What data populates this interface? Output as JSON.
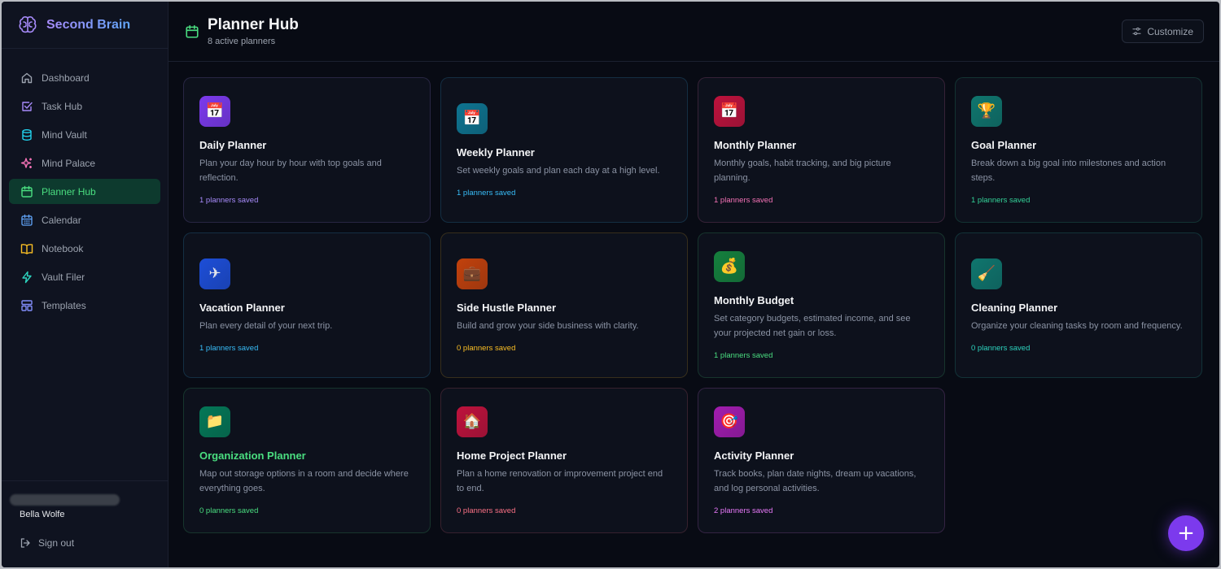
{
  "brand": {
    "name": "Second Brain"
  },
  "sidebar": {
    "items": [
      {
        "label": "Dashboard",
        "icon": "home-icon"
      },
      {
        "label": "Task Hub",
        "icon": "checkbox-icon"
      },
      {
        "label": "Mind Vault",
        "icon": "database-icon"
      },
      {
        "label": "Mind Palace",
        "icon": "sparkles-icon"
      },
      {
        "label": "Planner Hub",
        "icon": "calendar-icon",
        "active": true
      },
      {
        "label": "Calendar",
        "icon": "calendar-grid-icon"
      },
      {
        "label": "Notebook",
        "icon": "book-icon"
      },
      {
        "label": "Vault Filer",
        "icon": "lightning-icon"
      },
      {
        "label": "Templates",
        "icon": "layout-icon"
      }
    ],
    "user": {
      "name": "Bella Wolfe"
    },
    "signout_label": "Sign out"
  },
  "header": {
    "title": "Planner Hub",
    "subtitle": "8 active planners",
    "customize_label": "Customize"
  },
  "cards": [
    {
      "title": "Daily Planner",
      "desc": "Plan your day hour by hour with top goals and reflection.",
      "status": "1 planners saved",
      "icon": "calendar-icon",
      "emoji": "📅",
      "color": "#a78bfa",
      "icon_bg": "#7c3aed"
    },
    {
      "title": "Weekly Planner",
      "desc": "Set weekly goals and plan each day at a high level.",
      "status": "1 planners saved",
      "icon": "calendar-icon",
      "emoji": "📅",
      "color": "#38bdf8",
      "icon_bg": "#0e7490"
    },
    {
      "title": "Monthly Planner",
      "desc": "Monthly goals, habit tracking, and big picture planning.",
      "status": "1 planners saved",
      "icon": "calendar-icon",
      "emoji": "📅",
      "color": "#f472b6",
      "icon_bg": "#be123c"
    },
    {
      "title": "Goal Planner",
      "desc": "Break down a big goal into milestones and action steps.",
      "status": "1 planners saved",
      "icon": "trophy-icon",
      "emoji": "🏆",
      "color": "#34d399",
      "icon_bg": "#0f766e"
    },
    {
      "title": "Vacation Planner",
      "desc": "Plan every detail of your next trip.",
      "status": "1 planners saved",
      "icon": "airplane-icon",
      "emoji": "✈",
      "color": "#38bdf8",
      "icon_bg": "#1d4ed8"
    },
    {
      "title": "Side Hustle Planner",
      "desc": "Build and grow your side business with clarity.",
      "status": "0 planners saved",
      "icon": "briefcase-icon",
      "emoji": "💼",
      "color": "#fbbf24",
      "icon_bg": "#c2410c"
    },
    {
      "title": "Monthly Budget",
      "desc": "Set category budgets, estimated income, and see your projected net gain or loss.",
      "status": "1 planners saved",
      "icon": "money-bag-icon",
      "emoji": "💰",
      "color": "#4ade80",
      "icon_bg": "#15803d"
    },
    {
      "title": "Cleaning Planner",
      "desc": "Organize your cleaning tasks by room and frequency.",
      "status": "0 planners saved",
      "icon": "broom-icon",
      "emoji": "🧹",
      "color": "#2dd4bf",
      "icon_bg": "#0f766e"
    },
    {
      "title": "Organization Planner",
      "desc": "Map out storage options in a room and decide where everything goes.",
      "status": "0 planners saved",
      "icon": "folder-icon",
      "emoji": "📁",
      "color": "#4ade80",
      "icon_bg": "#047857",
      "title_color": "#4ade80"
    },
    {
      "title": "Home Project Planner",
      "desc": "Plan a home renovation or improvement project end to end.",
      "status": "0 planners saved",
      "icon": "house-icon",
      "emoji": "🏠",
      "color": "#fb7185",
      "icon_bg": "#be123c"
    },
    {
      "title": "Activity Planner",
      "desc": "Track books, plan date nights, dream up vacations, and log personal activities.",
      "status": "2 planners saved",
      "icon": "target-icon",
      "emoji": "🎯",
      "color": "#e879f9",
      "icon_bg": "#a21caf"
    }
  ],
  "fab": {
    "label": "+"
  }
}
